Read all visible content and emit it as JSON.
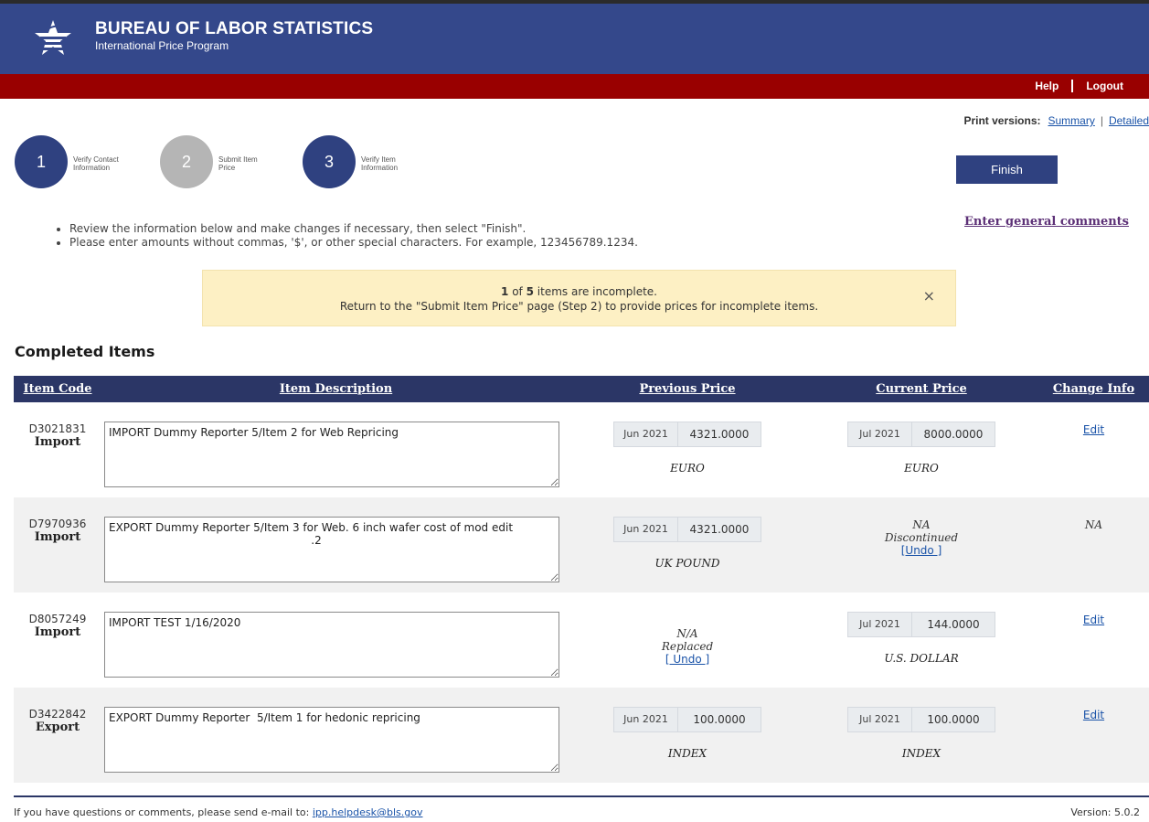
{
  "header": {
    "org_name": "BUREAU OF LABOR STATISTICS",
    "program": "International Price Program"
  },
  "topnav": {
    "help": "Help",
    "logout": "Logout"
  },
  "print": {
    "label": "Print versions:",
    "summary": "Summary",
    "detailed": "Detailed"
  },
  "steps": [
    {
      "num": "1",
      "label": "Verify Contact Information",
      "state": "active"
    },
    {
      "num": "2",
      "label": "Submit Item Price",
      "state": "inactive"
    },
    {
      "num": "3",
      "label": "Verify Item Information",
      "state": "active"
    }
  ],
  "finish_label": "Finish",
  "comments_link": "Enter general comments",
  "instructions": [
    "Review the information below and make changes if necessary, then select \"Finish\".",
    "Please enter amounts without commas, '$', or other special characters. For example, 123456789.1234."
  ],
  "alert": {
    "count": "1",
    "of": "of",
    "total": "5",
    "text1": "items are incomplete.",
    "text2": "Return to the \"Submit Item Price\" page (Step 2) to provide prices for incomplete items.",
    "close": "×"
  },
  "section_title": "Completed Items",
  "table": {
    "headers": [
      "Item Code",
      "Item Description",
      "Previous Price",
      "Current Price",
      "Change Info"
    ],
    "rows": [
      {
        "code": "D3021831",
        "type": "Import",
        "description": "IMPORT Dummy Reporter 5/Item 2 for Web Repricing",
        "prev_date": "Jun 2021",
        "prev_value": "4321.0000",
        "prev_currency": "EURO",
        "cur_date": "Jul 2021",
        "cur_value": "8000.0000",
        "cur_currency": "EURO",
        "change": "Edit"
      },
      {
        "code": "D7970936",
        "type": "Import",
        "description": "EXPORT Dummy Reporter 5/Item 3 for Web. 6 inch wafer cost of mod edit\n                                                          .2",
        "prev_date": "Jun 2021",
        "prev_value": "4321.0000",
        "prev_currency": "UK POUND",
        "cur_na": "NA",
        "cur_status": "Discontinued",
        "cur_undo": "[Undo ]",
        "change": "NA"
      },
      {
        "code": "D8057249",
        "type": "Import",
        "description": "IMPORT TEST 1/16/2020",
        "prev_na": "N/A",
        "prev_status": "Replaced",
        "prev_undo": "[ Undo ]",
        "cur_date": "Jul 2021",
        "cur_value": "144.0000",
        "cur_currency": "U.S. DOLLAR",
        "change": "Edit"
      },
      {
        "code": "D3422842",
        "type": "Export",
        "description": "EXPORT Dummy Reporter  5/Item 1 for hedonic repricing",
        "prev_date": "Jun 2021",
        "prev_value": "100.0000",
        "prev_currency": "INDEX",
        "cur_date": "Jul 2021",
        "cur_value": "100.0000",
        "cur_currency": "INDEX",
        "change": "Edit"
      }
    ]
  },
  "footer": {
    "text": "If you have questions or comments, please send e-mail to:",
    "email": "ipp.helpdesk@bls.gov",
    "version": "Version: 5.0.2"
  },
  "colors": {
    "header_bg": "#34488b",
    "nav_red": "#990000",
    "table_header": "#2b3666",
    "step_active": "#2f4180",
    "step_inactive": "#b5b5b5",
    "alert_bg": "#fdf0c4"
  }
}
